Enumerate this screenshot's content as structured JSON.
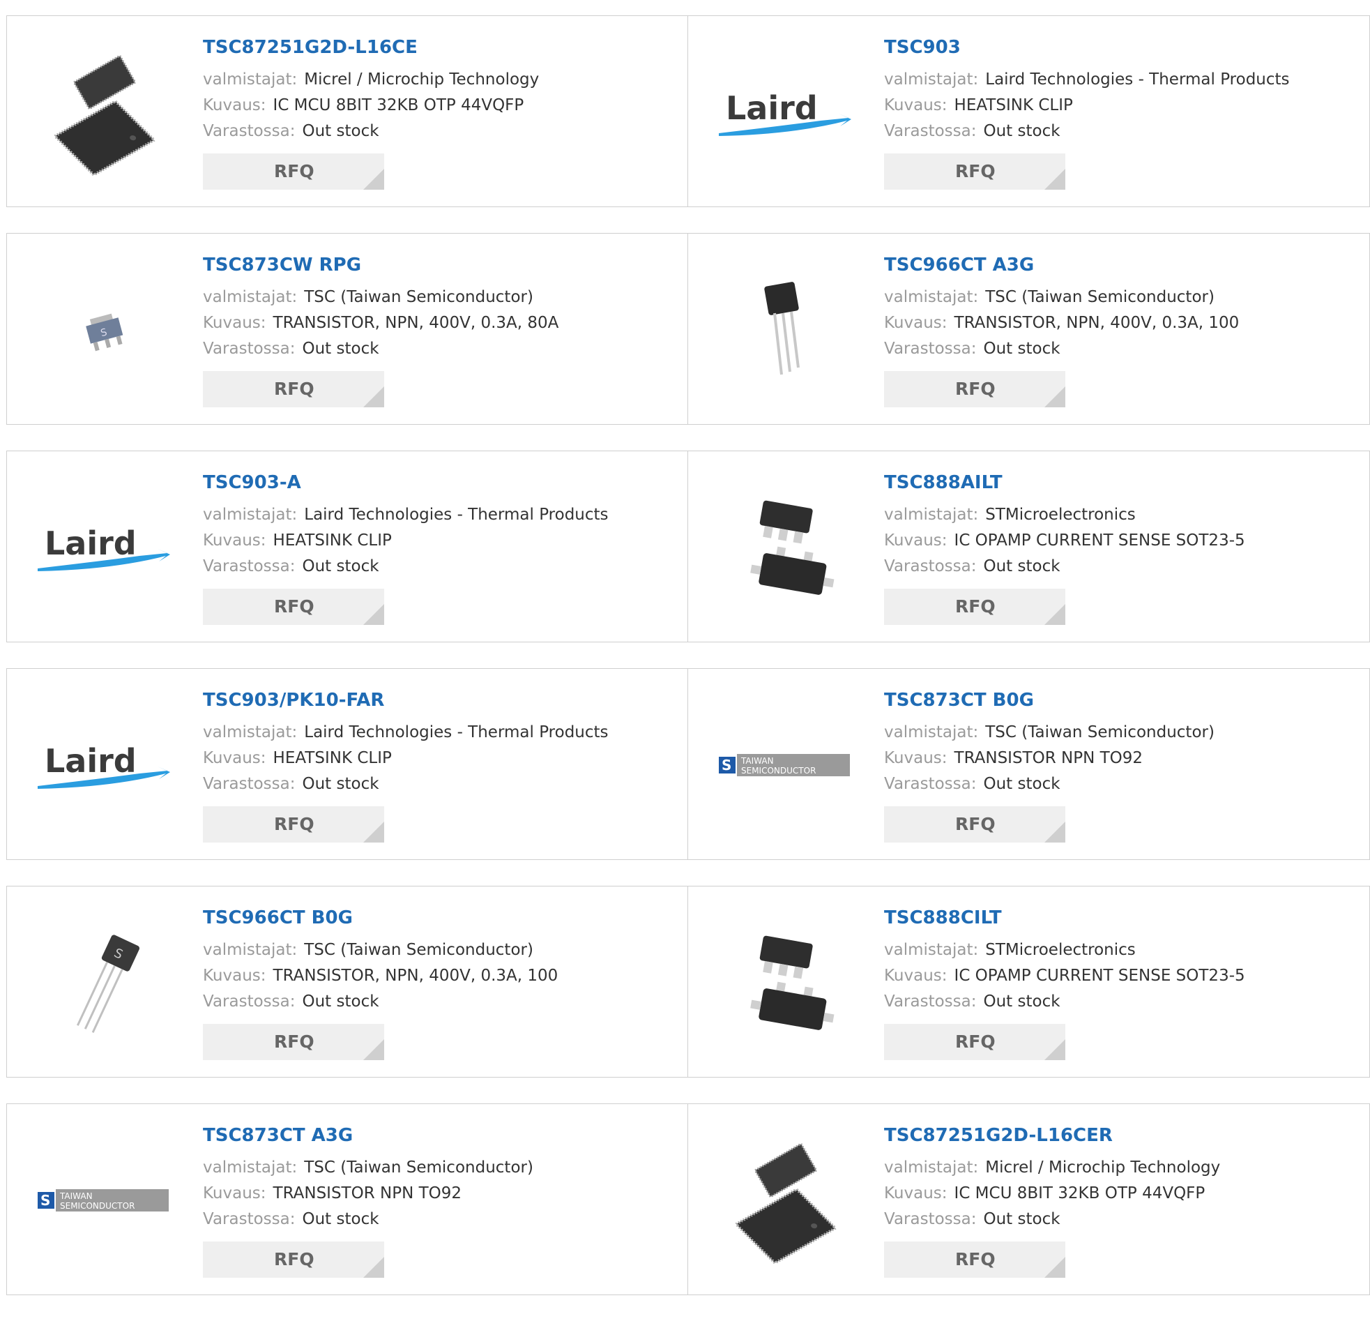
{
  "labels": {
    "manufacturer": "valmistajat:",
    "description": "Kuvaus:",
    "stock": "Varastossa:",
    "rfq": "RFQ"
  },
  "products": [
    {
      "part": "TSC87251G2D-L16CE",
      "manufacturer": "Micrel / Microchip Technology",
      "description": "IC MCU 8BIT 32KB OTP 44VQFP",
      "stock": "Out stock",
      "image": "qfp-chip-icon"
    },
    {
      "part": "TSC903",
      "manufacturer": "Laird Technologies - Thermal Products",
      "description": "HEATSINK CLIP",
      "stock": "Out stock",
      "image": "laird-logo",
      "logo_text": "Laird"
    },
    {
      "part": "TSC873CW RPG",
      "manufacturer": "TSC (Taiwan Semiconductor)",
      "description": "TRANSISTOR, NPN, 400V, 0.3A, 80A",
      "stock": "Out stock",
      "image": "sot-chip-icon"
    },
    {
      "part": "TSC966CT A3G",
      "manufacturer": "TSC (Taiwan Semiconductor)",
      "description": "TRANSISTOR, NPN, 400V, 0.3A, 100",
      "stock": "Out stock",
      "image": "to92-transistor-icon"
    },
    {
      "part": "TSC903-A",
      "manufacturer": "Laird Technologies - Thermal Products",
      "description": "HEATSINK CLIP",
      "stock": "Out stock",
      "image": "laird-logo",
      "logo_text": "Laird"
    },
    {
      "part": "TSC888AILT",
      "manufacturer": "STMicroelectronics",
      "description": "IC OPAMP CURRENT SENSE SOT23-5",
      "stock": "Out stock",
      "image": "sot23-chip-icon"
    },
    {
      "part": "TSC903/PK10-FAR",
      "manufacturer": "Laird Technologies - Thermal Products",
      "description": "HEATSINK CLIP",
      "stock": "Out stock",
      "image": "laird-logo",
      "logo_text": "Laird"
    },
    {
      "part": "TSC873CT B0G",
      "manufacturer": "TSC (Taiwan Semiconductor)",
      "description": "TRANSISTOR NPN TO92",
      "stock": "Out stock",
      "image": "taiwan-semiconductor-logo",
      "logo_text": [
        "TAIWAN",
        "SEMICONDUCTOR"
      ]
    },
    {
      "part": "TSC966CT B0G",
      "manufacturer": "TSC (Taiwan Semiconductor)",
      "description": "TRANSISTOR, NPN, 400V, 0.3A, 100",
      "stock": "Out stock",
      "image": "to92-angled-transistor-icon"
    },
    {
      "part": "TSC888CILT",
      "manufacturer": "STMicroelectronics",
      "description": "IC OPAMP CURRENT SENSE SOT23-5",
      "stock": "Out stock",
      "image": "sot23-chip-icon"
    },
    {
      "part": "TSC873CT A3G",
      "manufacturer": "TSC (Taiwan Semiconductor)",
      "description": "TRANSISTOR NPN TO92",
      "stock": "Out stock",
      "image": "taiwan-semiconductor-logo",
      "logo_text": [
        "TAIWAN",
        "SEMICONDUCTOR"
      ]
    },
    {
      "part": "TSC87251G2D-L16CER",
      "manufacturer": "Micrel / Microchip Technology",
      "description": "IC MCU 8BIT 32KB OTP 44VQFP",
      "stock": "Out stock",
      "image": "qfp-chip-icon"
    }
  ],
  "colors": {
    "link": "#1f6bb4",
    "label": "#9a9a9a",
    "value": "#333333",
    "border": "#cfcfcf",
    "button_bg": "#efefef",
    "button_text": "#666666",
    "laird_swoosh": "#2a9de0"
  }
}
